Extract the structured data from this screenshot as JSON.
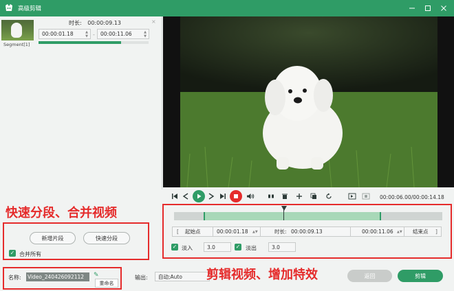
{
  "window": {
    "title": "高级剪辑"
  },
  "segment": {
    "label": "Segment[1]",
    "duration_label": "时长:",
    "duration_value": "00:00:09.13",
    "start_time": "00:00:01.18",
    "end_time": "00:00:11.06",
    "progress": 0.75
  },
  "annotations": {
    "left_caption": "快速分段、合并视频",
    "right_caption": "剪辑视频、增加特效"
  },
  "left_panel": {
    "add_segment_label": "新增片段",
    "quick_split_label": "快速分段",
    "merge_all_label": "合并所有",
    "merge_all_checked": true
  },
  "player": {
    "current_time": "00:00:06.00",
    "total_time": "00:00:14.18",
    "time_separator": "/"
  },
  "trim": {
    "start_point_label": "起始点",
    "start_value": "00:00:01.18",
    "duration_label": "时长:",
    "duration_value": "00:00:09.13",
    "end_value": "00:00:11.06",
    "end_point_label": "结束点",
    "fade_in_label": "淡入",
    "fade_in_value": "3.0",
    "fade_out_label": "淡出",
    "fade_out_value": "3.0"
  },
  "bottom": {
    "name_label": "名称:",
    "name_value": "Video_240426092112",
    "rename_tip": "重命名",
    "output_label": "输出:",
    "output_value": "自动;Auto",
    "back_label": "返回",
    "cut_label": "剪辑"
  },
  "colors": {
    "accent": "#2f9c66",
    "annotation": "#e52b2b"
  }
}
